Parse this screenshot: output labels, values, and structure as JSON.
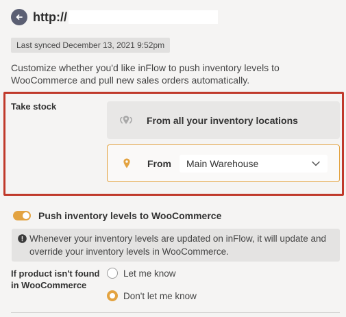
{
  "header": {
    "url_text": "http://"
  },
  "sync": {
    "label": "Last synced December 13, 2021 9:52pm"
  },
  "description": "Customize whether you'd like inFlow to push inventory levels to WooCommerce and pull new sales orders automatically.",
  "take_stock": {
    "label": "Take stock",
    "option_all": "From all your inventory locations",
    "option_from": "From",
    "selected_location": "Main Warehouse"
  },
  "push": {
    "enabled": true,
    "label": "Push inventory levels to WooCommerce",
    "info": "Whenever your inventory levels are updated on inFlow, it will update and override your inventory levels in WooCommerce."
  },
  "not_found": {
    "label": "If product isn't found in WooCommerce",
    "options": [
      "Let me know",
      "Don't let me know"
    ],
    "selected": "Don't let me know"
  },
  "colors": {
    "accent": "#e3a341",
    "highlight_border": "#c0392b"
  }
}
